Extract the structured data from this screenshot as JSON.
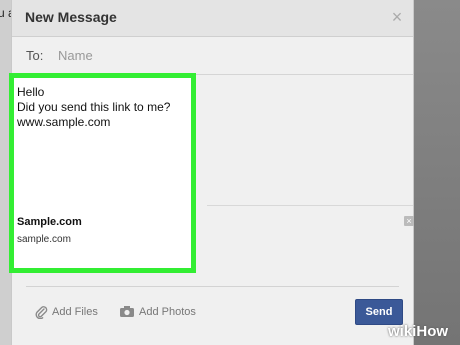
{
  "background": {
    "snippet": "u a"
  },
  "dialog": {
    "title": "New Message",
    "close_icon": "close-icon",
    "to_label": "To:",
    "to_placeholder": "Name"
  },
  "composer": {
    "message_lines": [
      "Hello",
      "Did you send this link to me?",
      "www.sample.com"
    ],
    "link_preview": {
      "title": "Sample.com",
      "url": "sample.com"
    },
    "highlight_color": "#33ee33"
  },
  "footer": {
    "add_files": "Add Files",
    "add_photos": "Add Photos",
    "send": "Send"
  },
  "watermark": {
    "wiki": "wiki",
    "how": "How"
  },
  "colors": {
    "send_button": "#3b5998"
  }
}
